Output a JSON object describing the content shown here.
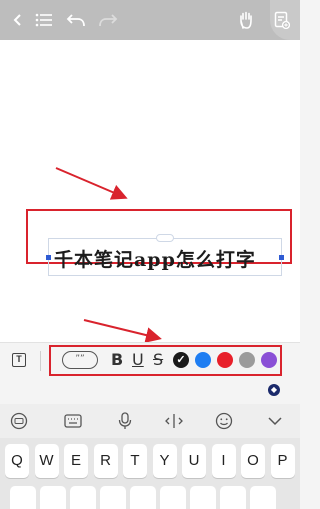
{
  "topbar": {
    "icons": [
      "back-icon",
      "list-icon",
      "undo-icon",
      "redo-icon",
      "hand-icon",
      "add-page-icon"
    ]
  },
  "note": {
    "text": "千本笔记app怎么打字"
  },
  "format_toolbar": {
    "text_tool_glyph": "T",
    "quote_glyph": "””",
    "bold": "B",
    "underline": "U",
    "strikethrough": "S",
    "colors": [
      "#1a1a1a",
      "#1f7ef2",
      "#e8202a",
      "#9b9b9b",
      "#8a4fd6"
    ],
    "selected_color_index": 0,
    "check_glyph": "✓"
  },
  "keyboard": {
    "toolbar_icons": [
      "keyboard-switch-icon",
      "keyboard-icon",
      "microphone-icon",
      "cursor-move-icon",
      "emoji-icon",
      "collapse-icon"
    ],
    "row1": [
      "Q",
      "W",
      "E",
      "R",
      "T",
      "Y",
      "U",
      "I",
      "O",
      "P"
    ]
  },
  "colors": {
    "annotation_red": "#d9232d",
    "handle_blue": "#2f5bd3"
  }
}
